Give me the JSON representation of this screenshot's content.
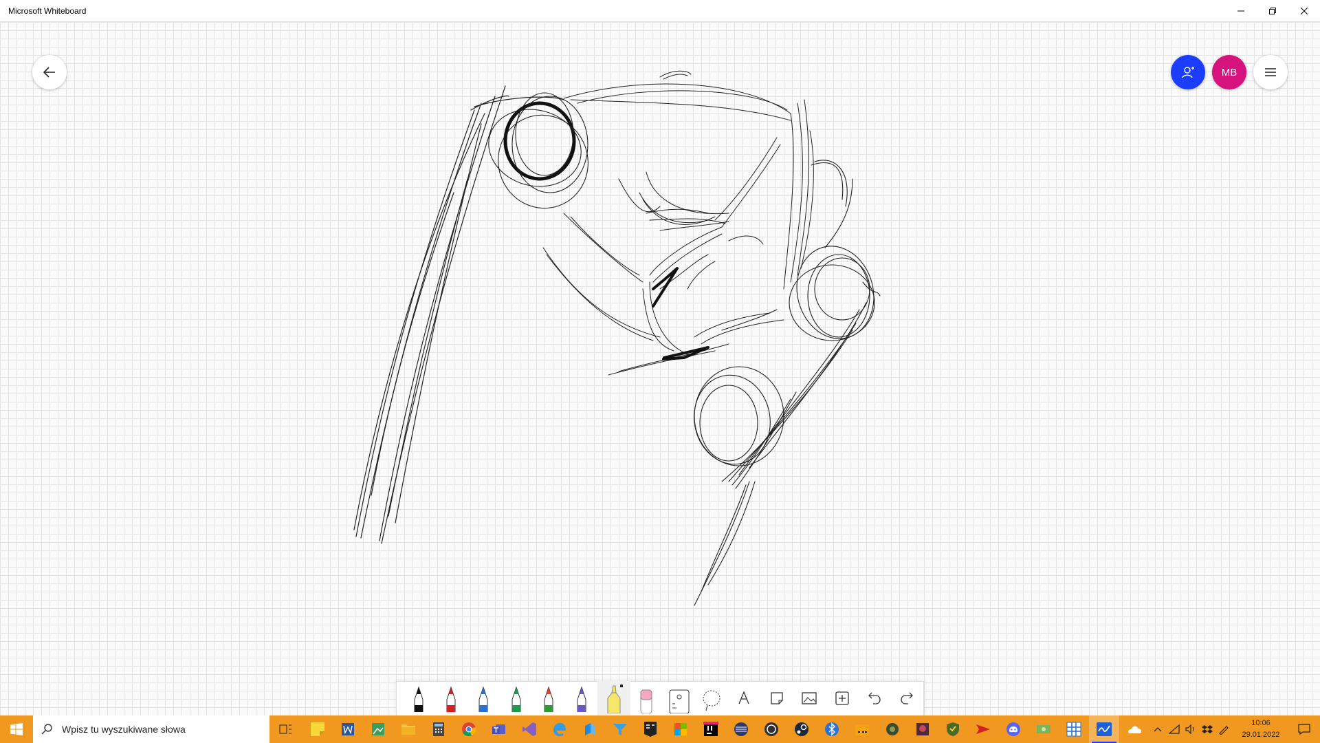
{
  "window": {
    "title": "Microsoft Whiteboard",
    "controls": [
      "minimize",
      "restore",
      "close"
    ]
  },
  "header": {
    "back_icon": "arrow-left-icon",
    "share_icon": "person-add-icon",
    "avatar_initials": "MB",
    "menu_icon": "hamburger-menu-icon",
    "colors": {
      "share": "#1a3dff",
      "avatar": "#d6127f"
    }
  },
  "canvas": {
    "grid": true,
    "content": "freehand pencil sketch"
  },
  "toolbar": {
    "tools": [
      {
        "name": "pen-black",
        "color": "#111111"
      },
      {
        "name": "pen-red",
        "color": "#d42020"
      },
      {
        "name": "pen-blue",
        "color": "#2a6fd1"
      },
      {
        "name": "pen-green",
        "color": "#1f9a4c"
      },
      {
        "name": "pen-red-2",
        "color": "#e0402a"
      },
      {
        "name": "pen-purple",
        "color": "#6b56c8"
      },
      {
        "name": "highlighter",
        "color": "#f4e76a",
        "selected": true
      },
      {
        "name": "eraser",
        "color": "#f5a8c0"
      },
      {
        "name": "ruler"
      },
      {
        "name": "lasso"
      },
      {
        "name": "text"
      },
      {
        "name": "sticky-note"
      },
      {
        "name": "image"
      },
      {
        "name": "insert"
      },
      {
        "name": "undo"
      },
      {
        "name": "redo"
      }
    ]
  },
  "taskbar": {
    "search_placeholder": "Wpisz tu wyszukiwane słowa",
    "apps": [
      "task-view",
      "sticky-notes",
      "word-app",
      "photos",
      "file-explorer",
      "calculator",
      "chrome",
      "teams",
      "visual-studio",
      "edge-legacy",
      "app-blue",
      "filter-app",
      "epic-games",
      "office",
      "jetbrains",
      "discord-app-alt",
      "obs",
      "steam",
      "bitwarden",
      "folder-orange",
      "game-app",
      "game-app-2",
      "shield-app",
      "red-arrow-app",
      "discord",
      "money-app",
      "grid-app",
      "whiteboard"
    ],
    "clock_time": "10:06",
    "clock_date": "29.01.2022"
  }
}
